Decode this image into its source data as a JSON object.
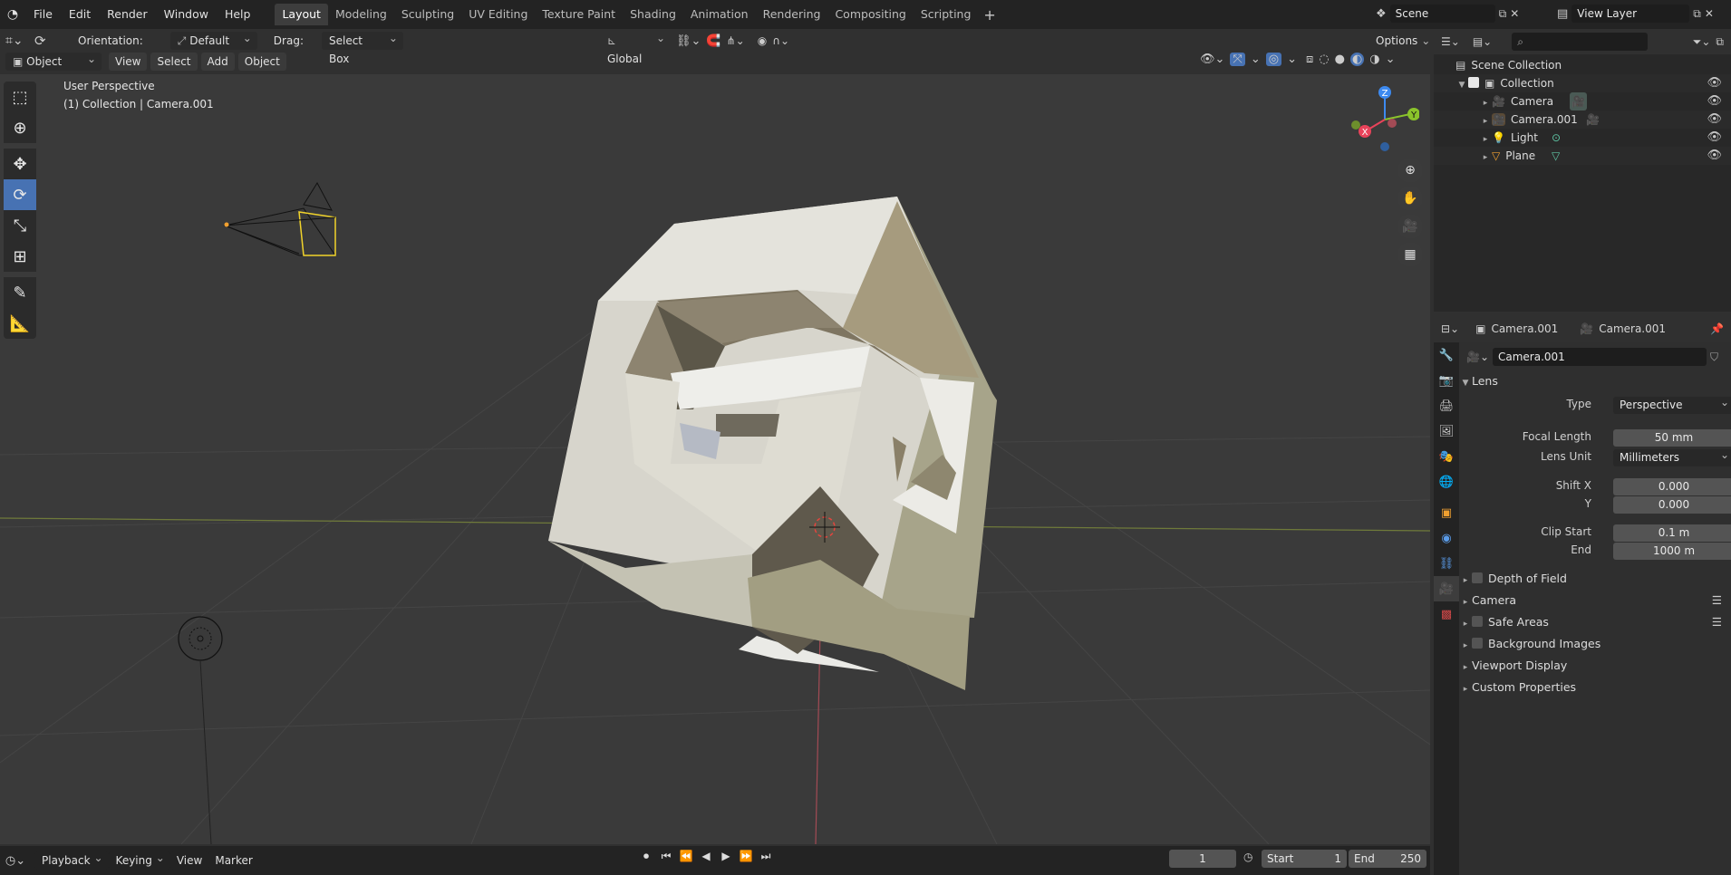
{
  "menubar": {
    "items": [
      "File",
      "Edit",
      "Render",
      "Window",
      "Help"
    ],
    "workspaces": [
      "Layout",
      "Modeling",
      "Sculpting",
      "UV Editing",
      "Texture Paint",
      "Shading",
      "Animation",
      "Rendering",
      "Compositing",
      "Scripting"
    ],
    "active_workspace": "Layout",
    "scene": "Scene",
    "view_layer": "View Layer"
  },
  "tool_header": {
    "orientation_label": "Orientation:",
    "orientation_value": "Default",
    "drag_label": "Drag:",
    "drag_value": "Select Box",
    "transform_orientation": "Global",
    "options": "Options"
  },
  "view_header": {
    "mode": "Object Mode",
    "menus": [
      "View",
      "Select",
      "Add",
      "Object"
    ]
  },
  "viewport": {
    "perspective": "User Perspective",
    "context": "(1) Collection | Camera.001",
    "gizmo": {
      "z": "Z",
      "x": "X",
      "y": "Y"
    }
  },
  "timeline": {
    "menus": [
      "Playback",
      "Keying",
      "View",
      "Marker"
    ],
    "current_frame": "1",
    "start_label": "Start",
    "start": "1",
    "end_label": "End",
    "end": "250"
  },
  "outliner": {
    "root": "Scene Collection",
    "collection": "Collection",
    "items": [
      {
        "name": "Camera",
        "icon": "camera-data-icon"
      },
      {
        "name": "Camera.001",
        "icon": "camera-data-icon"
      },
      {
        "name": "Light",
        "icon": "light-data-icon"
      },
      {
        "name": "Plane",
        "icon": "mesh-data-icon"
      }
    ]
  },
  "properties": {
    "object_name": "Camera.001",
    "data_name": "Camera.001",
    "datablock": "Camera.001",
    "lens_section": "Lens",
    "type_label": "Type",
    "type_value": "Perspective",
    "focal_length_label": "Focal Length",
    "focal_length": "50 mm",
    "lens_unit_label": "Lens Unit",
    "lens_unit": "Millimeters",
    "shift_x_label": "Shift X",
    "shift_x": "0.000",
    "shift_y_label": "Y",
    "shift_y": "0.000",
    "clip_start_label": "Clip Start",
    "clip_start": "0.1 m",
    "clip_end_label": "End",
    "clip_end": "1000 m",
    "panels": [
      "Depth of Field",
      "Camera",
      "Safe Areas",
      "Background Images",
      "Viewport Display",
      "Custom Properties"
    ]
  },
  "colors": {
    "accent": "#4772b3",
    "selected_outline": "#f1d32b",
    "axis_x": "#e8435a",
    "axis_y": "#8bc42b",
    "axis_z": "#3d8af0"
  }
}
